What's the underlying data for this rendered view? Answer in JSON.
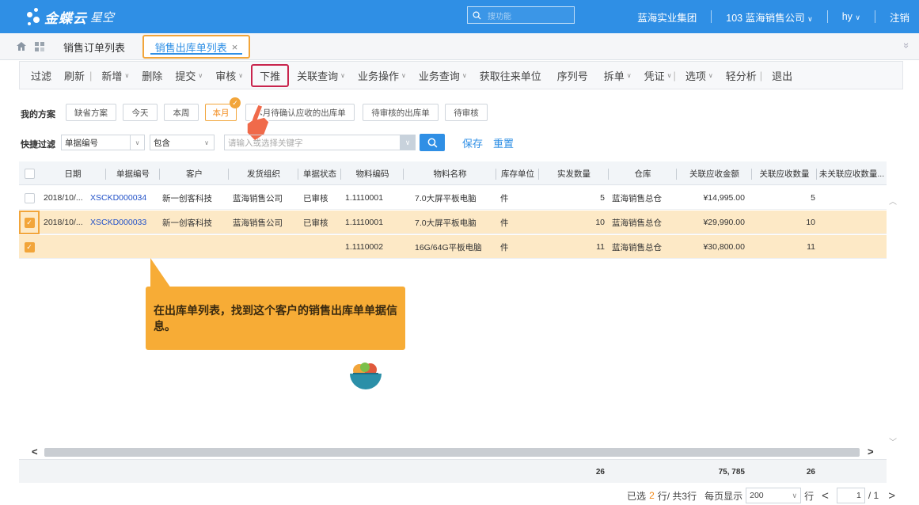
{
  "topbar": {
    "brand": "金蝶云",
    "brand_sub": "星空",
    "search_placeholder": "搜功能",
    "org": "蓝海实业集团",
    "company": "103 蓝海销售公司",
    "user": "hy",
    "logout": "注销"
  },
  "tabs": {
    "list": "销售订单列表",
    "active": "销售出库单列表",
    "close": "×",
    "collapse": "»"
  },
  "toolbar": {
    "filter": "过滤",
    "refresh": "刷新",
    "add": "新增",
    "delete": "删除",
    "submit": "提交",
    "audit": "审核",
    "push_down": "下推",
    "linked_query": "关联查询",
    "business_ops": "业务操作",
    "business_query": "业务查询",
    "get_partner": "获取往来单位",
    "serial_no": "序列号",
    "split": "拆单",
    "voucher": "凭证",
    "options": "选项",
    "light_analysis": "轻分析",
    "exit": "退出"
  },
  "scheme": {
    "label": "我的方案",
    "buttons": [
      "缺省方案",
      "今天",
      "本周",
      "本月",
      "本月待确认应收的出库单",
      "待审核的出库单",
      "待审核"
    ]
  },
  "quick_filter": {
    "label": "快捷过滤",
    "field": "单据编号",
    "operator": "包含",
    "keyword_placeholder": "请输入或选择关键字",
    "save": "保存",
    "reset": "重置"
  },
  "grid": {
    "headers": [
      "日期",
      "单据编号",
      "客户",
      "发货组织",
      "单据状态",
      "物料编码",
      "物料名称",
      "库存单位",
      "实发数量",
      "仓库",
      "关联应收金额",
      "关联应收数量",
      "未关联应收数量..."
    ],
    "rows": [
      {
        "checked": false,
        "date": "2018/10/...",
        "bill_no": "XSCKD000034",
        "customer": "新一创客科技",
        "org": "蓝海销售公司",
        "status": "已审核",
        "material_code": "1.1110001",
        "material_name": "7.0大屏平板电脑",
        "unit": "件",
        "qty": "5",
        "warehouse": "蓝海销售总仓",
        "amount": "¥14,995.00",
        "linked_qty": "5"
      },
      {
        "checked": true,
        "date": "2018/10/...",
        "bill_no": "XSCKD000033",
        "customer": "新一创客科技",
        "org": "蓝海销售公司",
        "status": "已审核",
        "material_code": "1.1110001",
        "material_name": "7.0大屏平板电脑",
        "unit": "件",
        "qty": "10",
        "warehouse": "蓝海销售总仓",
        "amount": "¥29,990.00",
        "linked_qty": "10"
      },
      {
        "checked": true,
        "date": "",
        "bill_no": "",
        "customer": "",
        "org": "",
        "status": "",
        "material_code": "1.1110002",
        "material_name": "16G/64G平板电脑",
        "unit": "件",
        "qty": "11",
        "warehouse": "蓝海销售总仓",
        "amount": "¥30,800.00",
        "linked_qty": "11"
      }
    ],
    "totals": {
      "qty": "26",
      "amount": "75, 785",
      "linked_qty": "26"
    }
  },
  "callout": {
    "text": "在出库单列表，找到这个客户的销售出库单单据信息。"
  },
  "pager": {
    "selected_prefix": "已选",
    "selected_count": "2",
    "selected_suffix": "行/ 共3行",
    "per_page_label": "每页显示",
    "per_page": "200",
    "rows_unit": "行",
    "page": "1",
    "pages": "/ 1"
  },
  "colors": {
    "primary": "#2f8fe5",
    "accent": "#f2a53a",
    "highlight": "#c8244d",
    "selected_row": "#fde9c6"
  }
}
